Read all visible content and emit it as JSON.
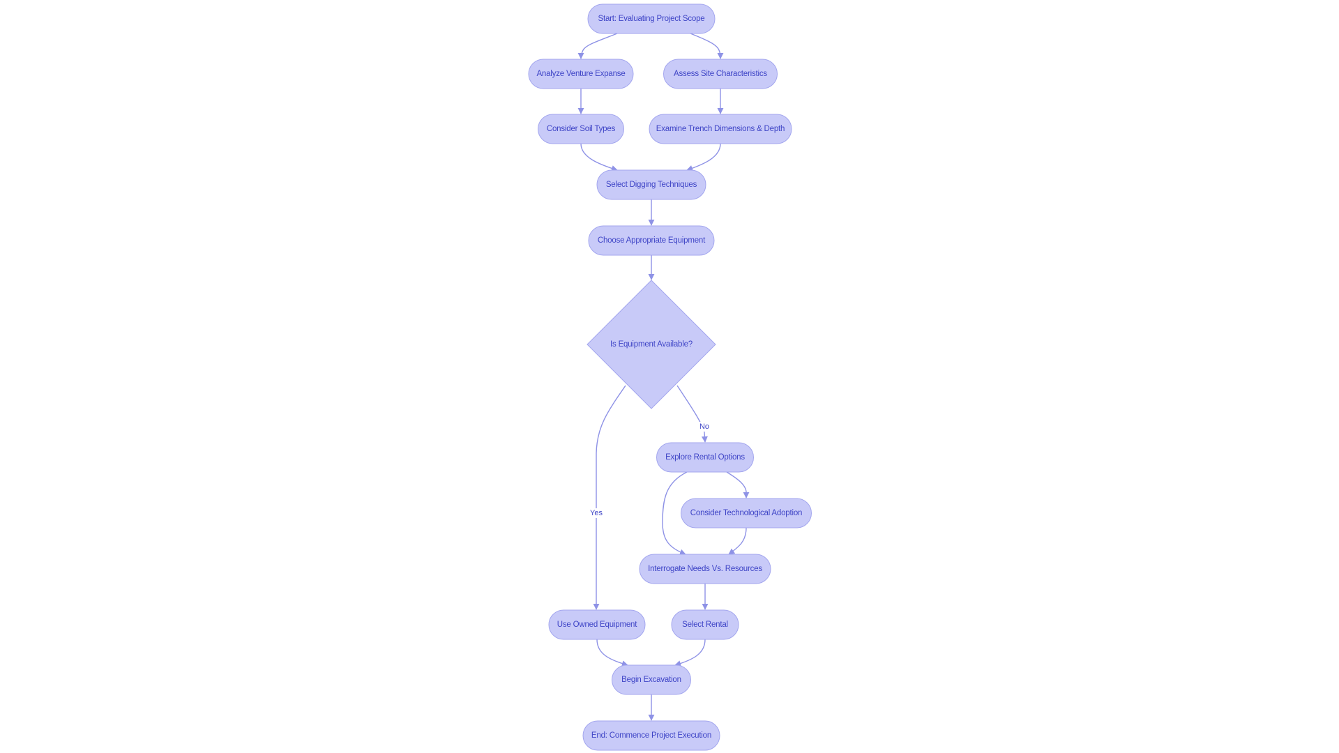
{
  "diagram": {
    "type": "flowchart",
    "direction": "top-down",
    "colors": {
      "node_fill": "#C8CAF8",
      "node_stroke": "#A3A6EE",
      "text": "#3E44C6",
      "edge": "#8E92E6"
    },
    "nodes": [
      {
        "id": "start",
        "label": "Start: Evaluating Project Scope",
        "shape": "stadium"
      },
      {
        "id": "analyze",
        "label": "Analyze Venture Expanse",
        "shape": "stadium"
      },
      {
        "id": "assess",
        "label": "Assess Site Characteristics",
        "shape": "stadium"
      },
      {
        "id": "soil",
        "label": "Consider Soil Types",
        "shape": "stadium"
      },
      {
        "id": "trench",
        "label": "Examine Trench Dimensions & Depth",
        "shape": "stadium"
      },
      {
        "id": "digging",
        "label": "Select Digging Techniques",
        "shape": "stadium"
      },
      {
        "id": "choose",
        "label": "Choose Appropriate Equipment",
        "shape": "stadium"
      },
      {
        "id": "available",
        "label": "Is Equipment Available?",
        "shape": "diamond"
      },
      {
        "id": "explore",
        "label": "Explore Rental Options",
        "shape": "stadium"
      },
      {
        "id": "tech",
        "label": "Consider Technological Adoption",
        "shape": "stadium"
      },
      {
        "id": "interrogate",
        "label": "Interrogate Needs Vs. Resources",
        "shape": "stadium"
      },
      {
        "id": "owned",
        "label": "Use Owned Equipment",
        "shape": "stadium"
      },
      {
        "id": "rental",
        "label": "Select Rental",
        "shape": "stadium"
      },
      {
        "id": "begin",
        "label": "Begin Excavation",
        "shape": "stadium"
      },
      {
        "id": "end",
        "label": "End: Commence Project Execution",
        "shape": "stadium"
      }
    ],
    "edges": [
      {
        "from": "start",
        "to": "analyze",
        "label": ""
      },
      {
        "from": "start",
        "to": "assess",
        "label": ""
      },
      {
        "from": "analyze",
        "to": "soil",
        "label": ""
      },
      {
        "from": "assess",
        "to": "trench",
        "label": ""
      },
      {
        "from": "soil",
        "to": "digging",
        "label": ""
      },
      {
        "from": "trench",
        "to": "digging",
        "label": ""
      },
      {
        "from": "digging",
        "to": "choose",
        "label": ""
      },
      {
        "from": "choose",
        "to": "available",
        "label": ""
      },
      {
        "from": "available",
        "to": "owned",
        "label": "Yes"
      },
      {
        "from": "available",
        "to": "explore",
        "label": "No"
      },
      {
        "from": "explore",
        "to": "tech",
        "label": ""
      },
      {
        "from": "explore",
        "to": "interrogate",
        "label": ""
      },
      {
        "from": "tech",
        "to": "interrogate",
        "label": ""
      },
      {
        "from": "interrogate",
        "to": "rental",
        "label": ""
      },
      {
        "from": "owned",
        "to": "begin",
        "label": ""
      },
      {
        "from": "rental",
        "to": "begin",
        "label": ""
      },
      {
        "from": "begin",
        "to": "end",
        "label": ""
      }
    ]
  }
}
